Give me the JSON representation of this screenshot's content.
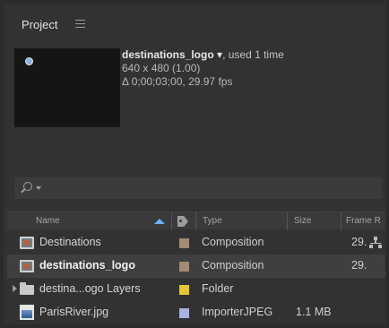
{
  "panel": {
    "title": "Project"
  },
  "preview": {
    "item_name": "destinations_logo",
    "item_dropdown_glyph": "▾",
    "usage": ", used 1 time",
    "dimensions": "640 x 480 (1.00)",
    "duration": "Δ 0;00;03;00, 29.97 fps"
  },
  "search": {
    "value": "",
    "icon": "search-icon"
  },
  "columns": {
    "name": "Name",
    "type": "Type",
    "size": "Size",
    "frame_rate": "Frame R"
  },
  "items": [
    {
      "name": "Destinations",
      "icon": "composition-icon",
      "label_color": "#a28b74",
      "type": "Composition",
      "size": "",
      "frame_rate": "29.",
      "selected": false,
      "expandable": false
    },
    {
      "name": "destinations_logo",
      "icon": "composition-icon",
      "label_color": "#a28b74",
      "type": "Composition",
      "size": "",
      "frame_rate": "29.",
      "selected": true,
      "expandable": false
    },
    {
      "name": "destina...ogo Layers",
      "icon": "folder-icon",
      "label_color": "#e5c62e",
      "type": "Folder",
      "size": "",
      "frame_rate": "",
      "selected": false,
      "expandable": true
    },
    {
      "name": "ParisRiver.jpg",
      "icon": "jpeg-file-icon",
      "label_color": "#a9b2e0",
      "type": "ImporterJPEG",
      "size": "1.1 MB",
      "frame_rate": "",
      "selected": false,
      "expandable": false
    }
  ],
  "colors": {
    "background": "#323232",
    "selected_row": "#3f3f3f",
    "accent": "#6ab0ff"
  }
}
